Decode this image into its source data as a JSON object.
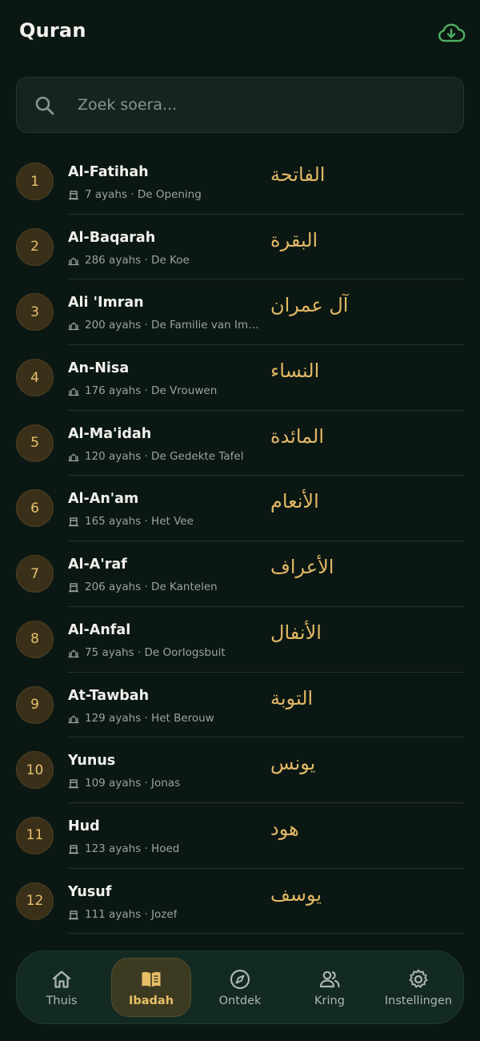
{
  "header": {
    "title": "Quran",
    "download_icon": "cloud-download-icon",
    "accent_color": "#4fae5f"
  },
  "search": {
    "placeholder": "Zoek soera..."
  },
  "surahs": [
    {
      "number": "1",
      "name": "Al-Fatihah",
      "meta": "7 ayahs · De Opening",
      "arabic": "الفاتحة",
      "place": "mecca"
    },
    {
      "number": "2",
      "name": "Al-Baqarah",
      "meta": "286 ayahs · De Koe",
      "arabic": "البقرة",
      "place": "medina"
    },
    {
      "number": "3",
      "name": "Ali 'Imran",
      "meta": "200 ayahs · De Familie van Imr…",
      "arabic": "آل عمران",
      "place": "medina"
    },
    {
      "number": "4",
      "name": "An-Nisa",
      "meta": "176 ayahs · De Vrouwen",
      "arabic": "النساء",
      "place": "medina"
    },
    {
      "number": "5",
      "name": "Al-Ma'idah",
      "meta": "120 ayahs · De Gedekte Tafel",
      "arabic": "المائدة",
      "place": "medina"
    },
    {
      "number": "6",
      "name": "Al-An'am",
      "meta": "165 ayahs · Het Vee",
      "arabic": "الأنعام",
      "place": "mecca"
    },
    {
      "number": "7",
      "name": "Al-A'raf",
      "meta": "206 ayahs · De Kantelen",
      "arabic": "الأعراف",
      "place": "mecca"
    },
    {
      "number": "8",
      "name": "Al-Anfal",
      "meta": "75 ayahs · De Oorlogsbuit",
      "arabic": "الأنفال",
      "place": "medina"
    },
    {
      "number": "9",
      "name": "At-Tawbah",
      "meta": "129 ayahs · Het Berouw",
      "arabic": "التوبة",
      "place": "medina"
    },
    {
      "number": "10",
      "name": "Yunus",
      "meta": "109 ayahs · Jonas",
      "arabic": "يونس",
      "place": "mecca"
    },
    {
      "number": "11",
      "name": "Hud",
      "meta": "123 ayahs · Hoed",
      "arabic": "هود",
      "place": "mecca"
    },
    {
      "number": "12",
      "name": "Yusuf",
      "meta": "111 ayahs · Jozef",
      "arabic": "يوسف",
      "place": "mecca"
    }
  ],
  "nav": {
    "active": "Ibadah",
    "items": [
      {
        "label": "Thuis",
        "icon": "home-icon"
      },
      {
        "label": "Ibadah",
        "icon": "book-icon"
      },
      {
        "label": "Ontdek",
        "icon": "compass-icon"
      },
      {
        "label": "Kring",
        "icon": "people-icon"
      },
      {
        "label": "Instellingen",
        "icon": "gear-icon"
      }
    ]
  },
  "colors": {
    "background": "#0b1713",
    "gold": "#e2b865",
    "badge_bg": "#3a3019"
  }
}
